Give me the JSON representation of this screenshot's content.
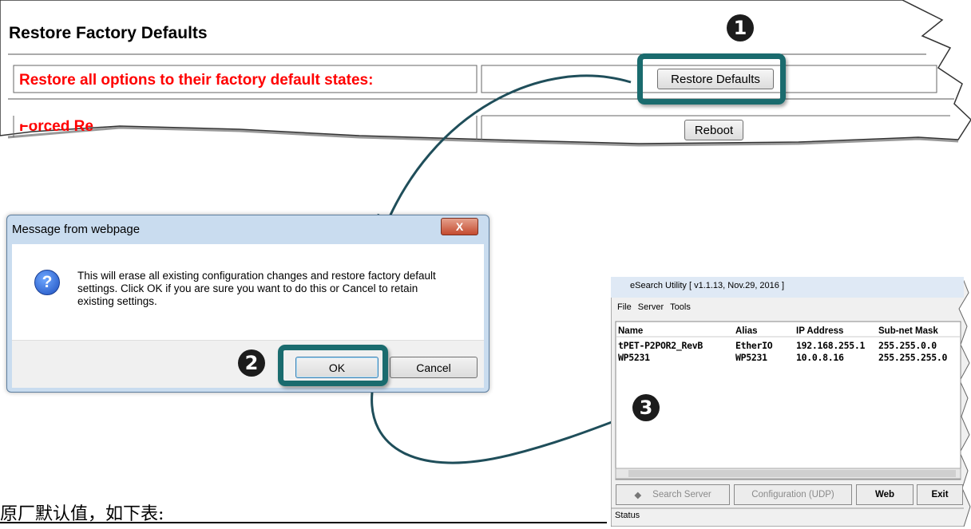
{
  "web": {
    "title": "Restore Factory Defaults",
    "row1_label": "Restore all options to their factory default states:",
    "row2_label_partial": "Forced Re",
    "restore_button": "Restore Defaults",
    "reboot_button": "Reboot"
  },
  "steps": [
    "1",
    "2",
    "3"
  ],
  "dialog": {
    "title": "Message from webpage",
    "close_label": "X",
    "message": "This will erase all existing configuration changes and restore factory default settings. Click OK if you are sure you want to do this or Cancel to retain existing settings.",
    "ok_label": "OK",
    "cancel_label": "Cancel"
  },
  "esearch": {
    "title": "eSearch Utility [ v1.1.13, Nov.29, 2016 ]",
    "menu": [
      "File",
      "Server",
      "Tools"
    ],
    "columns": [
      "Name",
      "Alias",
      "IP Address",
      "Sub-net Mask"
    ],
    "rows": [
      [
        "tPET-P2POR2_RevB",
        "EtherIO",
        "192.168.255.1",
        "255.255.0.0"
      ],
      [
        "WP5231",
        "WP5231",
        "10.0.8.16",
        "255.255.255.0"
      ]
    ],
    "buttons": {
      "search": "Search Server",
      "config": "Configuration (UDP)",
      "web": "Web",
      "exit": "Exit"
    },
    "status": "Status"
  },
  "bottom_text": "原厂默认值，如下表:",
  "colors": {
    "highlight": "#1a6b6e",
    "label_red": "#ff0000"
  }
}
